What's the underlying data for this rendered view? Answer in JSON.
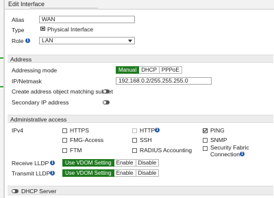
{
  "window": {
    "title": "Edit Interface"
  },
  "fields": {
    "alias_label": "Alias",
    "alias_value": "WAN",
    "type_label": "Type",
    "type_value": "Physical Interface",
    "role_label": "Role",
    "role_value": "LAN"
  },
  "address": {
    "section_title": "Address",
    "mode_label": "Addressing mode",
    "modes": [
      "Manual",
      "DHCP",
      "PPPoE"
    ],
    "active_mode": "Manual",
    "ipnetmask_label": "IP/Netmask",
    "ipnetmask_value": "192.168.0.2/255.255.255.0",
    "create_object_label": "Create address object matching subnet",
    "secondary_ip_label": "Secondary IP address"
  },
  "admin": {
    "section_title": "Administrative access",
    "ipv4_label": "IPv4",
    "options": [
      {
        "label": "HTTPS",
        "checked": false,
        "info": false,
        "dimmed": false
      },
      {
        "label": "HTTP",
        "checked": false,
        "info": true,
        "dimmed": true
      },
      {
        "label": "PING",
        "checked": true,
        "info": false,
        "dimmed": false
      },
      {
        "label": "FMG-Access",
        "checked": false,
        "info": false,
        "dimmed": false
      },
      {
        "label": "SSH",
        "checked": false,
        "info": false,
        "dimmed": false
      },
      {
        "label": "SNMP",
        "checked": false,
        "info": false,
        "dimmed": false
      },
      {
        "label": "FTM",
        "checked": false,
        "info": false,
        "dimmed": false
      },
      {
        "label": "RADIUS Accounting",
        "checked": false,
        "info": false,
        "dimmed": false
      },
      {
        "label": "Security Fabric",
        "label2": "Connection",
        "checked": false,
        "info": true,
        "dimmed": false
      }
    ],
    "receive_lldp_label": "Receive LLDP",
    "transmit_lldp_label": "Transmit LLDP",
    "lldp_options": [
      "Use VDOM Setting",
      "Enable",
      "Disable"
    ],
    "lldp_active": "Use VDOM Setting"
  },
  "dhcp": {
    "label": "DHCP Server"
  },
  "colors": {
    "accent": "#1f7a1f",
    "info": "#1f5aa6"
  }
}
